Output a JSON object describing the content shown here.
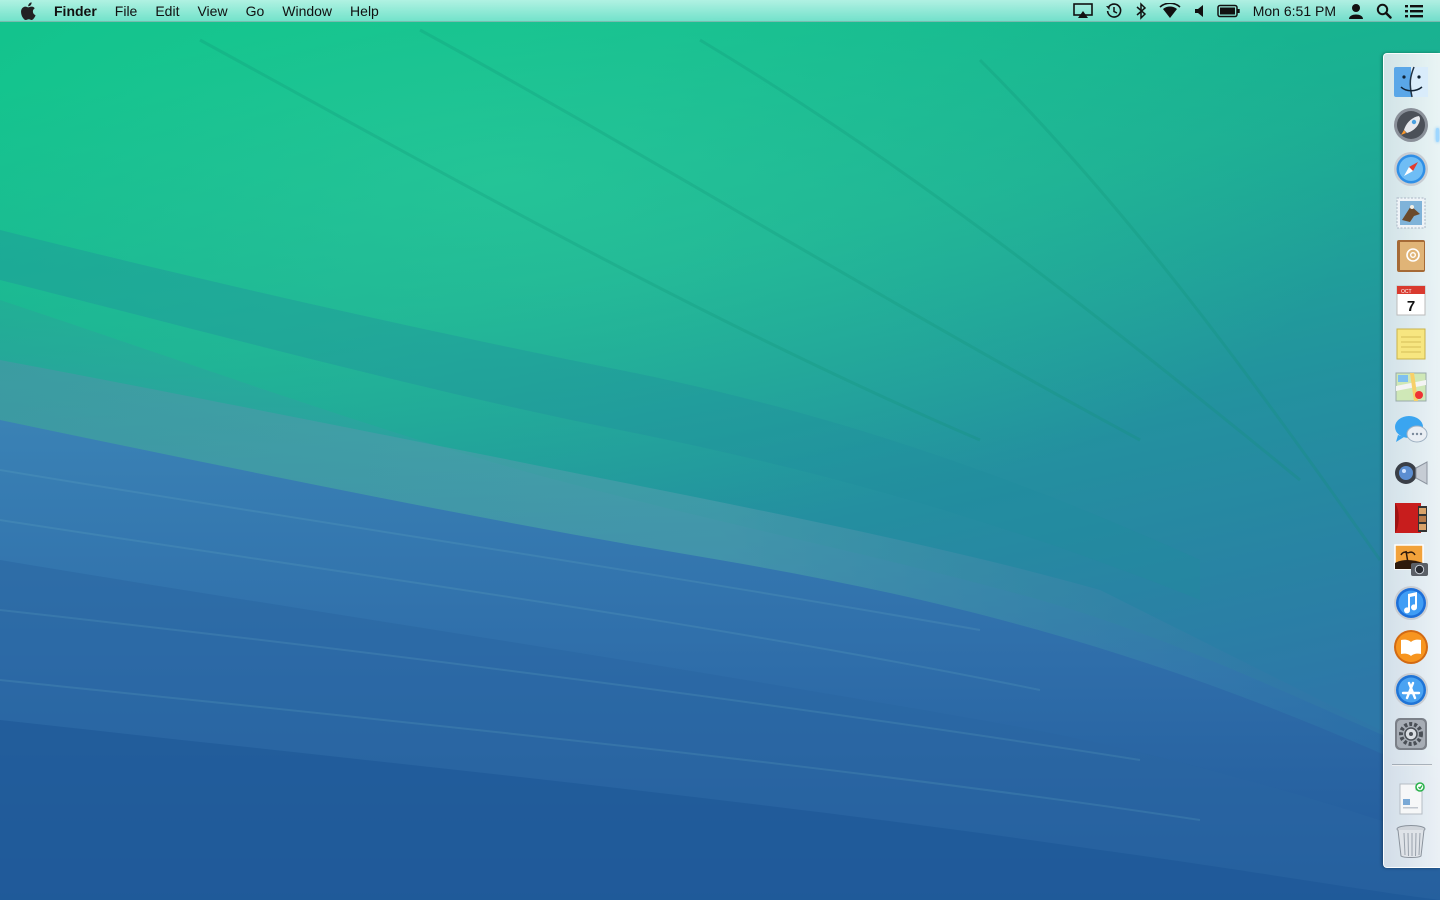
{
  "menubar": {
    "apple_icon": "apple-icon",
    "app_name": "Finder",
    "menus": [
      "File",
      "Edit",
      "View",
      "Go",
      "Window",
      "Help"
    ],
    "status_icons": [
      "airplay-icon",
      "time-machine-icon",
      "bluetooth-icon",
      "wifi-icon",
      "volume-icon",
      "battery-icon"
    ],
    "clock": "Mon 6:51 PM",
    "user_icon": "user-icon",
    "spotlight_icon": "spotlight-search-icon",
    "notification_icon": "notification-center-icon"
  },
  "dock": {
    "position": "right",
    "apps": [
      {
        "name": "Finder",
        "icon": "finder-icon",
        "running": true
      },
      {
        "name": "Launchpad",
        "icon": "launchpad-rocket-icon",
        "running": false
      },
      {
        "name": "Safari",
        "icon": "safari-compass-icon",
        "running": false
      },
      {
        "name": "Mail",
        "icon": "mail-stamp-icon",
        "running": false
      },
      {
        "name": "Contacts",
        "icon": "contacts-book-icon",
        "running": false
      },
      {
        "name": "Calendar",
        "icon": "calendar-icon",
        "running": false,
        "badge_month": "OCT",
        "badge_day": "7"
      },
      {
        "name": "Notes",
        "icon": "notes-icon",
        "running": false
      },
      {
        "name": "Maps",
        "icon": "maps-icon",
        "running": false
      },
      {
        "name": "Messages",
        "icon": "messages-bubble-icon",
        "running": false
      },
      {
        "name": "FaceTime",
        "icon": "facetime-camera-icon",
        "running": false
      },
      {
        "name": "Photo Booth",
        "icon": "photo-booth-icon",
        "running": false
      },
      {
        "name": "iPhoto",
        "icon": "iphoto-icon",
        "running": false
      },
      {
        "name": "iTunes",
        "icon": "itunes-note-icon",
        "running": false
      },
      {
        "name": "iBooks",
        "icon": "ibooks-icon",
        "running": false
      },
      {
        "name": "App Store",
        "icon": "app-store-icon",
        "running": false
      },
      {
        "name": "System Preferences",
        "icon": "system-preferences-gear-icon",
        "running": false
      }
    ],
    "others": [
      {
        "name": "Downloads",
        "icon": "downloads-stack-icon"
      },
      {
        "name": "Trash",
        "icon": "trash-icon"
      }
    ]
  },
  "colors": {
    "wave_green": "#19b38c",
    "wave_teal": "#2f9aa8",
    "ocean_blue": "#2f6fae",
    "deep_blue": "#1a5a98"
  }
}
